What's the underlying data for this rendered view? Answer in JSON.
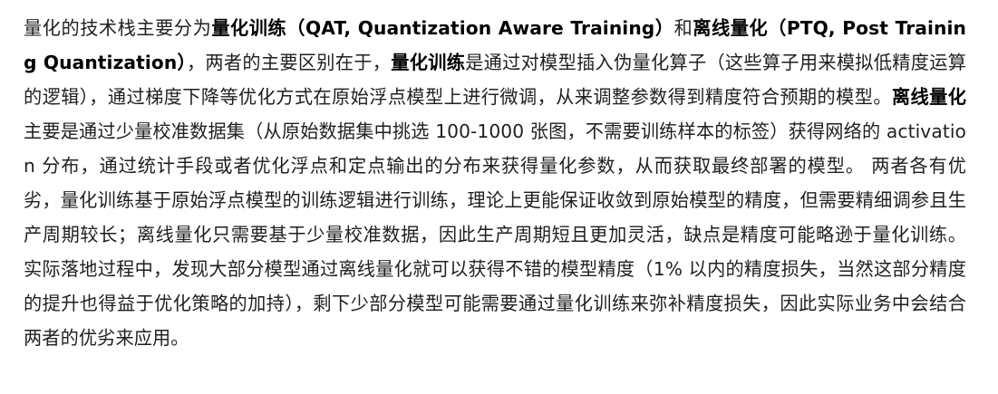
{
  "paragraph": {
    "s1_pre": "量化的技术栈主要分为",
    "qat_term": "量化训练（QAT, Quantization Aware Training）",
    "s1_and": "和",
    "ptq_term": "离线量化（PTQ, Post Training Quantization）",
    "s1_post": "，两者的主要区别在于，",
    "qat_short": "量化训练",
    "s2": "是通过对模型插入伪量化算子（这些算子用来模拟低精度运算的逻辑），通过梯度下降等优化方式在原始浮点模型上进行微调，从来调整参数得到精度符合预期的模型。",
    "ptq_short": "离线量化",
    "s3": "主要是通过少量校准数据集（从原始数据集中挑选 100-1000 张图，不需要训练样本的标签）获得网络的 activation 分布，通过统计手段或者优化浮点和定点输出的分布来获得量化参数，从而获取最终部署的模型。 两者各有优劣，量化训练基于原始浮点模型的训练逻辑进行训练，理论上更能保证收敛到原始模型的精度，但需要精细调参且生产周期较长；离线量化只需要基于少量校准数据，因此生产周期短且更加灵活，缺点是精度可能略逊于量化训练。 实际落地过程中，发现大部分模型通过离线量化就可以获得不错的模型精度（1% 以内的精度损失，当然这部分精度的提升也得益于优化策略的加持），剩下少部分模型可能需要通过量化训练来弥补精度损失，因此实际业务中会结合两者的优劣来应用。"
  }
}
